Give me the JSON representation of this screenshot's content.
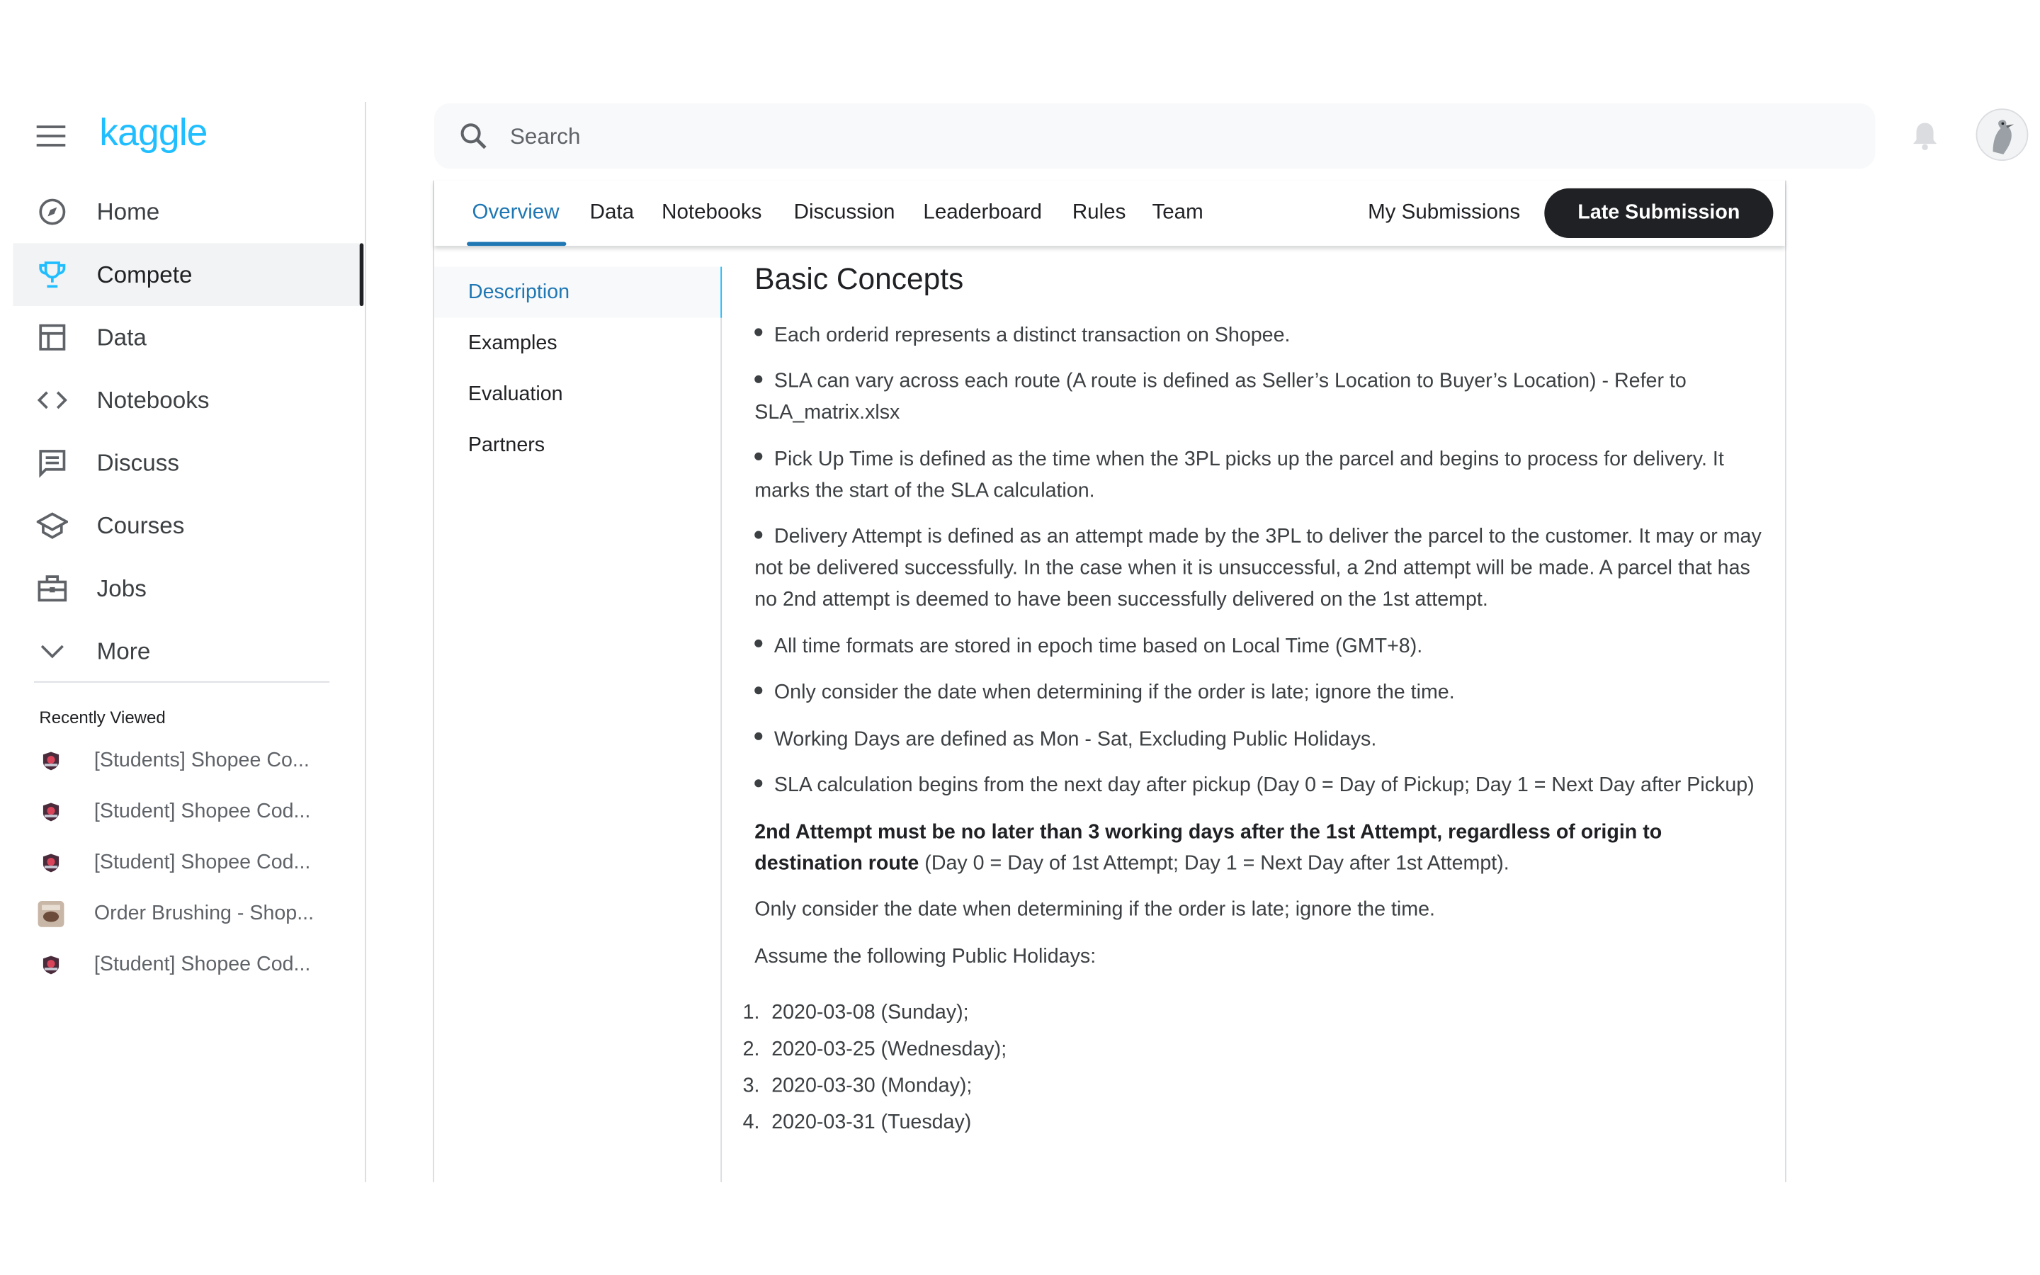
{
  "brand": {
    "name": "kaggle",
    "color": "#20beff"
  },
  "sidebar": {
    "items": [
      {
        "label": "Home",
        "icon": "compass-icon"
      },
      {
        "label": "Compete",
        "icon": "trophy-icon",
        "active": true
      },
      {
        "label": "Data",
        "icon": "table-icon"
      },
      {
        "label": "Notebooks",
        "icon": "code-icon"
      },
      {
        "label": "Discuss",
        "icon": "comment-icon"
      },
      {
        "label": "Courses",
        "icon": "school-icon"
      },
      {
        "label": "Jobs",
        "icon": "briefcase-icon"
      },
      {
        "label": "More",
        "icon": "chevron-down-icon"
      }
    ],
    "recent_title": "Recently Viewed",
    "recent": [
      {
        "label": "[Students] Shopee Co..."
      },
      {
        "label": "[Student] Shopee Cod..."
      },
      {
        "label": "[Student] Shopee Cod..."
      },
      {
        "label": "Order Brushing - Shop..."
      },
      {
        "label": "[Student] Shopee Cod..."
      }
    ]
  },
  "search": {
    "placeholder": "Search"
  },
  "tabs": {
    "items": [
      "Overview",
      "Data",
      "Notebooks",
      "Discussion",
      "Leaderboard",
      "Rules",
      "Team"
    ],
    "active": "Overview",
    "my_submissions": "My Submissions",
    "late_submission": "Late Submission"
  },
  "subnav": [
    "Description",
    "Examples",
    "Evaluation",
    "Partners"
  ],
  "content": {
    "heading": "Basic Concepts",
    "bullets": [
      "Each orderid represents a distinct transaction on Shopee.",
      "SLA can vary across each route (A route is defined as Seller’s Location to Buyer’s Location) - Refer to SLA_matrix.xlsx",
      "Pick Up Time is defined as the time when the 3PL picks up the parcel and begins to process for delivery. It marks the start of the SLA calculation.",
      "Delivery Attempt is defined as an attempt made by the 3PL to deliver the parcel to the customer. It may or may not be delivered successfully. In the case when it is unsuccessful, a 2nd attempt will be made. A parcel that has no 2nd attempt is deemed to have been successfully delivered on the 1st attempt.",
      "All time formats are stored in epoch time based on Local Time (GMT+8).",
      "Only consider the date when determining if the order is late; ignore the time.",
      "Working Days are defined as Mon - Sat, Excluding Public Holidays.",
      "SLA calculation begins from the next day after pickup (Day 0 = Day of Pickup; Day 1 = Next Day after Pickup)"
    ],
    "rule_bold": "2nd Attempt must be no later than 3 working days after the 1st Attempt, regardless of origin to destination route",
    "rule_rest": " (Day 0 = Day of 1st Attempt; Day 1 = Next Day after 1st Attempt).",
    "note": "Only consider the date when determining if the order is late; ignore the time.",
    "holidays_intro": "Assume the following Public Holidays:",
    "holidays": [
      {
        "num": "1.",
        "text": "2020-03-08 (Sunday);"
      },
      {
        "num": "2.",
        "text": "2020-03-25 (Wednesday);"
      },
      {
        "num": "3.",
        "text": "2020-03-30 (Monday);"
      },
      {
        "num": "4.",
        "text": "2020-03-31 (Tuesday)"
      }
    ]
  }
}
